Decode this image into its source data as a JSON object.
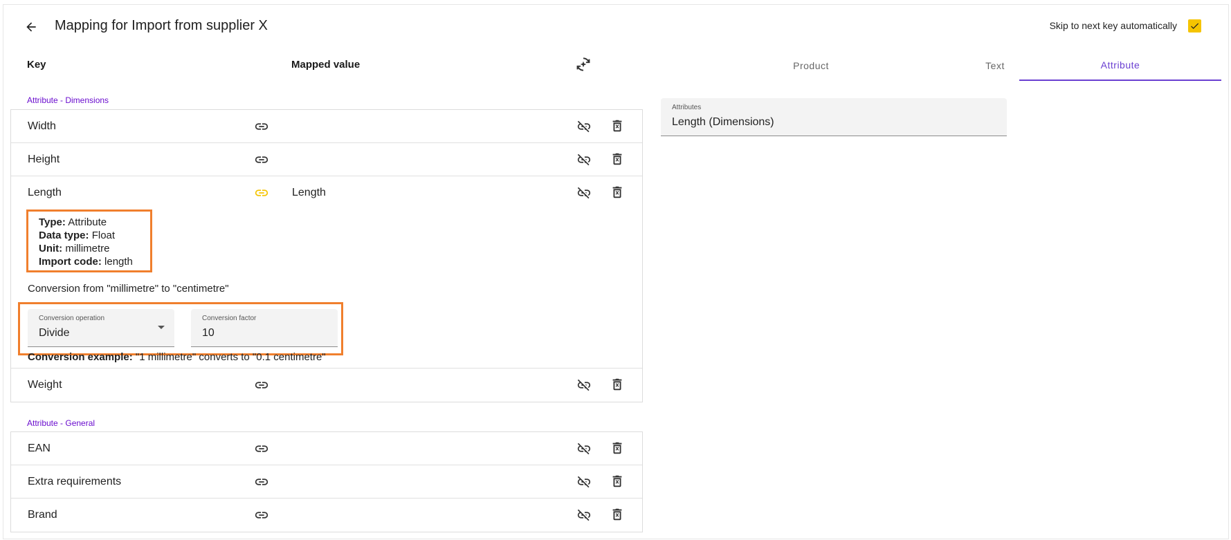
{
  "header": {
    "title": "Mapping for Import from supplier X",
    "skip_label": "Skip to next key automatically",
    "skip_checked": true,
    "accent_color": "#f5c400"
  },
  "columns": {
    "key": "Key",
    "mapped_value": "Mapped value"
  },
  "tabs": [
    {
      "label": "Product",
      "active": false
    },
    {
      "label": "Text",
      "active": false
    },
    {
      "label": "Attribute",
      "active": true
    }
  ],
  "groups": [
    {
      "label": "Attribute - Dimensions",
      "rows": [
        {
          "key": "Width",
          "mapped": ""
        },
        {
          "key": "Height",
          "mapped": ""
        },
        {
          "key": "Length",
          "mapped": "Length",
          "linked": true
        },
        {
          "key": "Weight",
          "mapped": ""
        }
      ]
    },
    {
      "label": "Attribute - General",
      "rows": [
        {
          "key": "EAN",
          "mapped": ""
        },
        {
          "key": "Extra requirements",
          "mapped": ""
        },
        {
          "key": "Brand",
          "mapped": ""
        }
      ]
    }
  ],
  "details": {
    "type_label": "Type:",
    "type_value": "Attribute",
    "datatype_label": "Data type:",
    "datatype_value": "Float",
    "unit_label": "Unit:",
    "unit_value": "millimetre",
    "importcode_label": "Import code:",
    "importcode_value": "length"
  },
  "conversion": {
    "title": "Conversion from \"millimetre\" to \"centimetre\"",
    "operation_label": "Conversion operation",
    "operation_value": "Divide",
    "factor_label": "Conversion factor",
    "factor_value": "10",
    "example_label": "Conversion example:",
    "example_value": "\"1 millimetre\" converts to \"0.1 centimetre\""
  },
  "attribute_field": {
    "label": "Attributes",
    "value": "Length (Dimensions)"
  },
  "colors": {
    "accent": "#6a3fd1",
    "group_label": "#6a0dce",
    "highlight": "#f07f2d",
    "linked_icon": "#f5c400"
  }
}
